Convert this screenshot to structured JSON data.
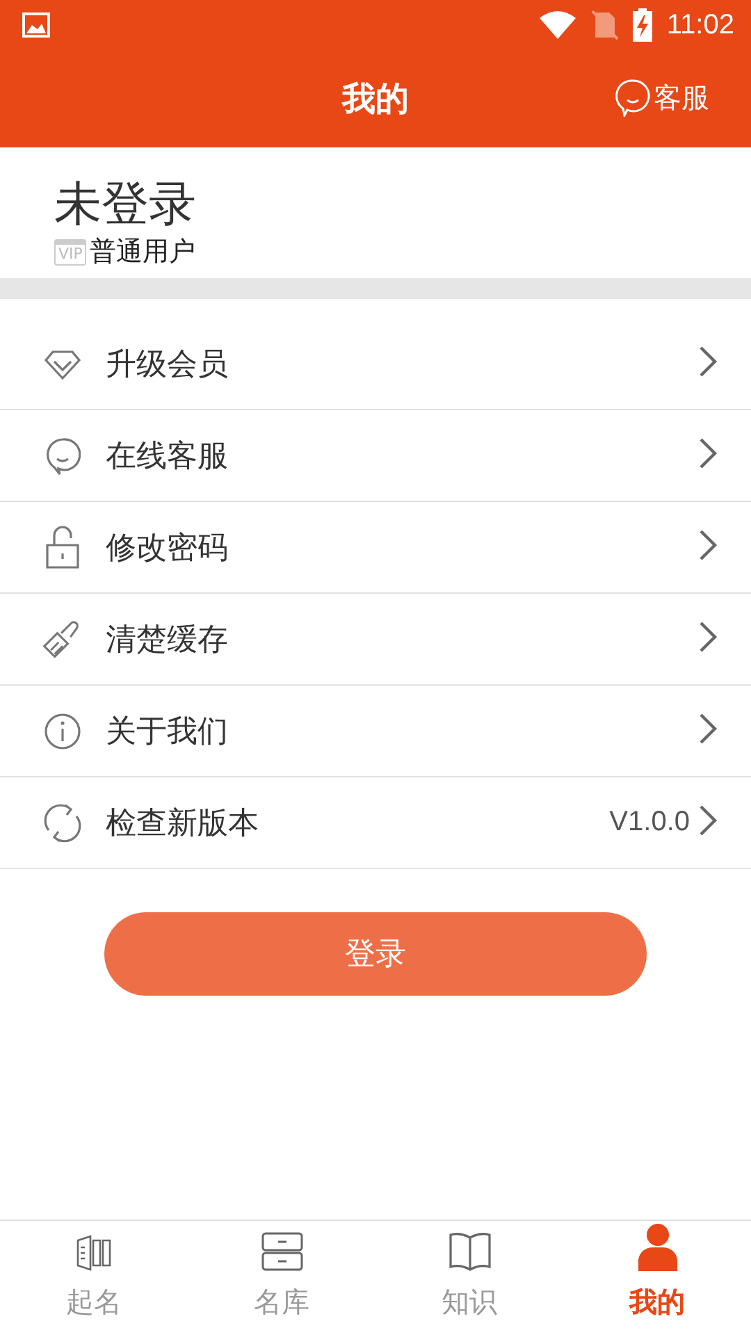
{
  "status_bar": {
    "time": "11:02"
  },
  "header": {
    "title": "我的",
    "service": "客服"
  },
  "profile": {
    "name": "未登录",
    "badge": "VIP",
    "level": "普通用户"
  },
  "menu": [
    {
      "label": "升级会员"
    },
    {
      "label": "在线客服"
    },
    {
      "label": "修改密码"
    },
    {
      "label": "清楚缓存"
    },
    {
      "label": "关于我们"
    },
    {
      "label": "检查新版本",
      "value": "V1.0.0"
    }
  ],
  "login_button": "登录",
  "tabs": [
    {
      "label": "起名",
      "selected": false
    },
    {
      "label": "名库",
      "selected": false
    },
    {
      "label": "知识",
      "selected": false
    },
    {
      "label": "我的",
      "selected": true
    }
  ]
}
